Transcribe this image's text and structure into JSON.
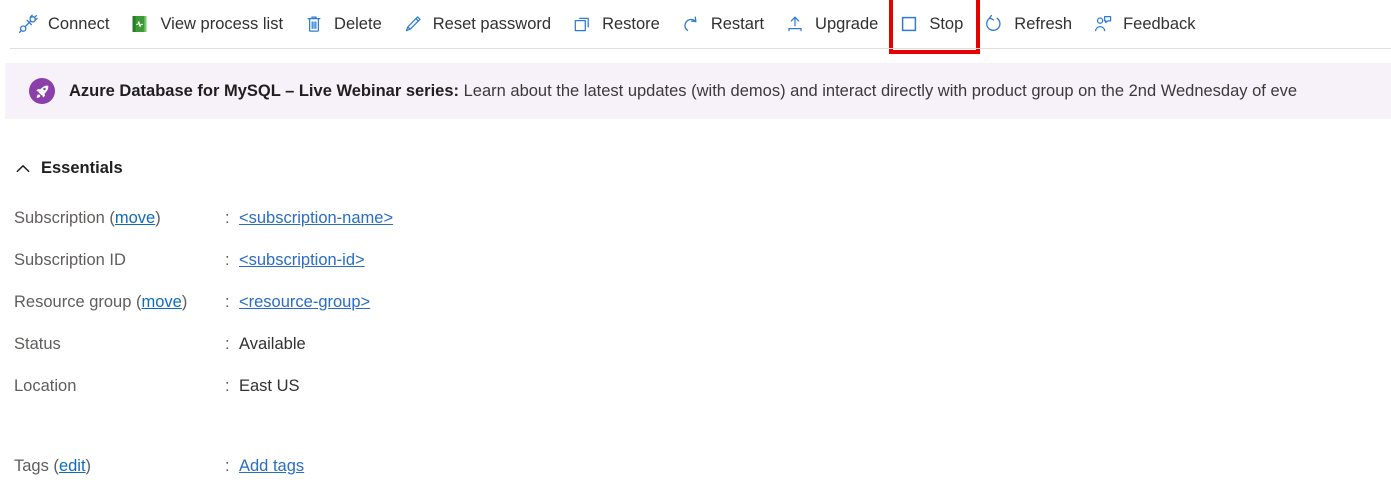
{
  "toolbar": {
    "commands": [
      {
        "label": "Connect",
        "icon": "plug-icon"
      },
      {
        "label": "View process list",
        "icon": "process-list-icon"
      },
      {
        "label": "Delete",
        "icon": "trash-icon"
      },
      {
        "label": "Reset password",
        "icon": "pencil-icon"
      },
      {
        "label": "Restore",
        "icon": "restore-icon"
      },
      {
        "label": "Restart",
        "icon": "restart-icon"
      },
      {
        "label": "Upgrade",
        "icon": "upgrade-icon"
      },
      {
        "label": "Stop",
        "icon": "stop-square-icon"
      },
      {
        "label": "Refresh",
        "icon": "refresh-icon"
      },
      {
        "label": "Feedback",
        "icon": "feedback-person-icon"
      }
    ],
    "highlight": {
      "target": "Stop",
      "color": "#e60000"
    }
  },
  "banner": {
    "icon": "rocket-icon",
    "icon_color": "#8b3fa8",
    "background": "#f7f2fa",
    "title": "Azure Database for MySQL – Live Webinar series:",
    "body": " Learn about the latest updates (with demos) and interact directly with product group on the 2nd Wednesday of eve"
  },
  "essentials": {
    "header": "Essentials",
    "collapse_icon": "chevron-up-icon",
    "colon": ":",
    "rows": [
      {
        "label_prefix": "Subscription (",
        "label_link": "move",
        "label_suffix": ")",
        "value": "<subscription-name>",
        "value_is_link": true
      },
      {
        "label_prefix": "Subscription ID",
        "label_link": "",
        "label_suffix": "",
        "value": "<subscription-id>",
        "value_is_link": true
      },
      {
        "label_prefix": "Resource group (",
        "label_link": "move",
        "label_suffix": ")",
        "value": "<resource-group>",
        "value_is_link": true
      },
      {
        "label_prefix": "Status",
        "label_link": "",
        "label_suffix": "",
        "value": "Available",
        "value_is_link": false
      },
      {
        "label_prefix": "Location",
        "label_link": "",
        "label_suffix": "",
        "value": "East US",
        "value_is_link": false
      }
    ],
    "tags": {
      "label_prefix": "Tags (",
      "label_link": "edit",
      "label_suffix": ")",
      "value": "Add tags"
    }
  },
  "colors": {
    "link": "#0f6cbd",
    "icon_blue": "#2e7bd4",
    "accent_purple": "#8b3fa8",
    "annotation_red": "#e60000"
  }
}
